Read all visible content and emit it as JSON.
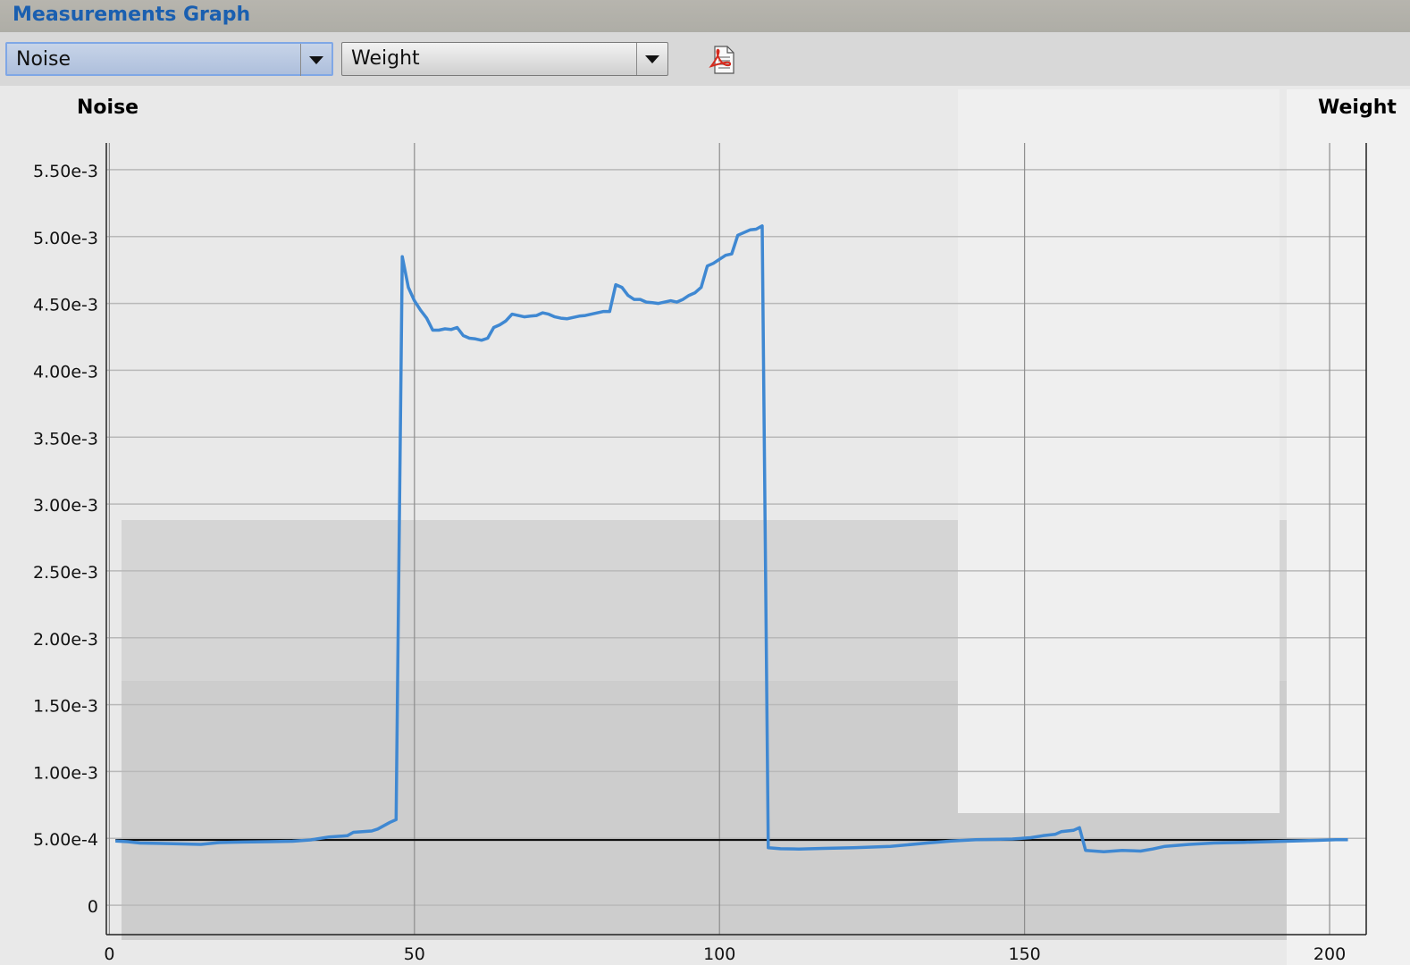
{
  "window": {
    "title": "Measurements Graph"
  },
  "toolbar": {
    "left_select": {
      "value": "Noise"
    },
    "right_select": {
      "value": "Weight"
    },
    "export_pdf_icon": "pdf-icon"
  },
  "colors": {
    "series": "#3f88d2",
    "reference_line": "#111111",
    "title": "#1a5fb0"
  },
  "chart_data": {
    "type": "line",
    "left_axis_title": "Noise",
    "right_axis_title": "Weight",
    "xlim": [
      -0.5,
      206
    ],
    "ylim": [
      -0.00022,
      0.0057
    ],
    "x_ticks": [
      0,
      50,
      100,
      150,
      200
    ],
    "x_tick_labels": [
      "0",
      "50",
      "100",
      "150",
      "200"
    ],
    "y_ticks": [
      0,
      0.0005,
      0.001,
      0.0015,
      0.002,
      0.0025,
      0.003,
      0.0035,
      0.004,
      0.0045,
      0.005,
      0.0055
    ],
    "y_tick_labels": [
      "0",
      "5.00e-4",
      "1.00e-3",
      "1.50e-3",
      "2.00e-3",
      "2.50e-3",
      "3.00e-3",
      "3.50e-3",
      "4.00e-3",
      "4.50e-3",
      "5.00e-3",
      "5.50e-3"
    ],
    "grid": true,
    "series": [
      {
        "values": [
          [
            1,
            0.00048
          ],
          [
            3,
            0.000475
          ],
          [
            5,
            0.000465
          ],
          [
            8,
            0.000462
          ],
          [
            12,
            0.000458
          ],
          [
            15,
            0.000455
          ],
          [
            18,
            0.000468
          ],
          [
            22,
            0.000472
          ],
          [
            26,
            0.000475
          ],
          [
            30,
            0.000478
          ],
          [
            33,
            0.000488
          ],
          [
            36,
            0.00051
          ],
          [
            39,
            0.00052
          ],
          [
            40,
            0.000545
          ],
          [
            43,
            0.000555
          ],
          [
            44,
            0.00057
          ],
          [
            46,
            0.00062
          ],
          [
            47,
            0.00064
          ],
          [
            48,
            0.00485
          ],
          [
            49,
            0.00462
          ],
          [
            50,
            0.00452
          ],
          [
            51,
            0.00445
          ],
          [
            52,
            0.00439
          ],
          [
            53,
            0.0043
          ],
          [
            54,
            0.0043
          ],
          [
            55,
            0.00431
          ],
          [
            56,
            0.004305
          ],
          [
            57,
            0.00432
          ],
          [
            58,
            0.00426
          ],
          [
            59,
            0.00424
          ],
          [
            60,
            0.004235
          ],
          [
            61,
            0.004225
          ],
          [
            62,
            0.00424
          ],
          [
            63,
            0.00432
          ],
          [
            64,
            0.00434
          ],
          [
            65,
            0.00437
          ],
          [
            66,
            0.00442
          ],
          [
            67,
            0.00441
          ],
          [
            68,
            0.0044
          ],
          [
            69,
            0.004405
          ],
          [
            70,
            0.00441
          ],
          [
            71,
            0.00443
          ],
          [
            72,
            0.00442
          ],
          [
            73,
            0.0044
          ],
          [
            74,
            0.00439
          ],
          [
            75,
            0.004385
          ],
          [
            76,
            0.004395
          ],
          [
            77,
            0.004405
          ],
          [
            78,
            0.00441
          ],
          [
            79,
            0.00442
          ],
          [
            80,
            0.00443
          ],
          [
            81,
            0.00444
          ],
          [
            82,
            0.00444
          ],
          [
            83,
            0.00464
          ],
          [
            84,
            0.00462
          ],
          [
            85,
            0.00456
          ],
          [
            86,
            0.00453
          ],
          [
            87,
            0.00453
          ],
          [
            88,
            0.00451
          ],
          [
            89,
            0.004505
          ],
          [
            90,
            0.0045
          ],
          [
            91,
            0.00451
          ],
          [
            92,
            0.00452
          ],
          [
            93,
            0.00451
          ],
          [
            94,
            0.00453
          ],
          [
            95,
            0.00456
          ],
          [
            96,
            0.00458
          ],
          [
            97,
            0.00462
          ],
          [
            98,
            0.00478
          ],
          [
            99,
            0.0048
          ],
          [
            100,
            0.00483
          ],
          [
            101,
            0.00486
          ],
          [
            102,
            0.00487
          ],
          [
            103,
            0.00501
          ],
          [
            104,
            0.00503
          ],
          [
            105,
            0.00505
          ],
          [
            106,
            0.005055
          ],
          [
            107,
            0.00508
          ],
          [
            108,
            0.00043
          ],
          [
            110,
            0.000422
          ],
          [
            113,
            0.00042
          ],
          [
            117,
            0.000425
          ],
          [
            122,
            0.00043
          ],
          [
            128,
            0.00044
          ],
          [
            134,
            0.000465
          ],
          [
            138,
            0.00048
          ],
          [
            142,
            0.00049
          ],
          [
            148,
            0.000495
          ],
          [
            151,
            0.000505
          ],
          [
            153,
            0.00052
          ],
          [
            155,
            0.00053
          ],
          [
            156,
            0.00055
          ],
          [
            158,
            0.00056
          ],
          [
            159,
            0.00058
          ],
          [
            160,
            0.00041
          ],
          [
            163,
            0.0004
          ],
          [
            166,
            0.00041
          ],
          [
            169,
            0.000405
          ],
          [
            171,
            0.00042
          ],
          [
            173,
            0.00044
          ],
          [
            177,
            0.000455
          ],
          [
            181,
            0.000465
          ],
          [
            186,
            0.00047
          ],
          [
            190,
            0.000475
          ],
          [
            194,
            0.00048
          ],
          [
            198,
            0.000485
          ],
          [
            201,
            0.00049
          ],
          [
            203,
            0.00049
          ]
        ]
      }
    ],
    "reference_line": {
      "y": 0.000488,
      "x_range": [
        1,
        203
      ]
    }
  }
}
